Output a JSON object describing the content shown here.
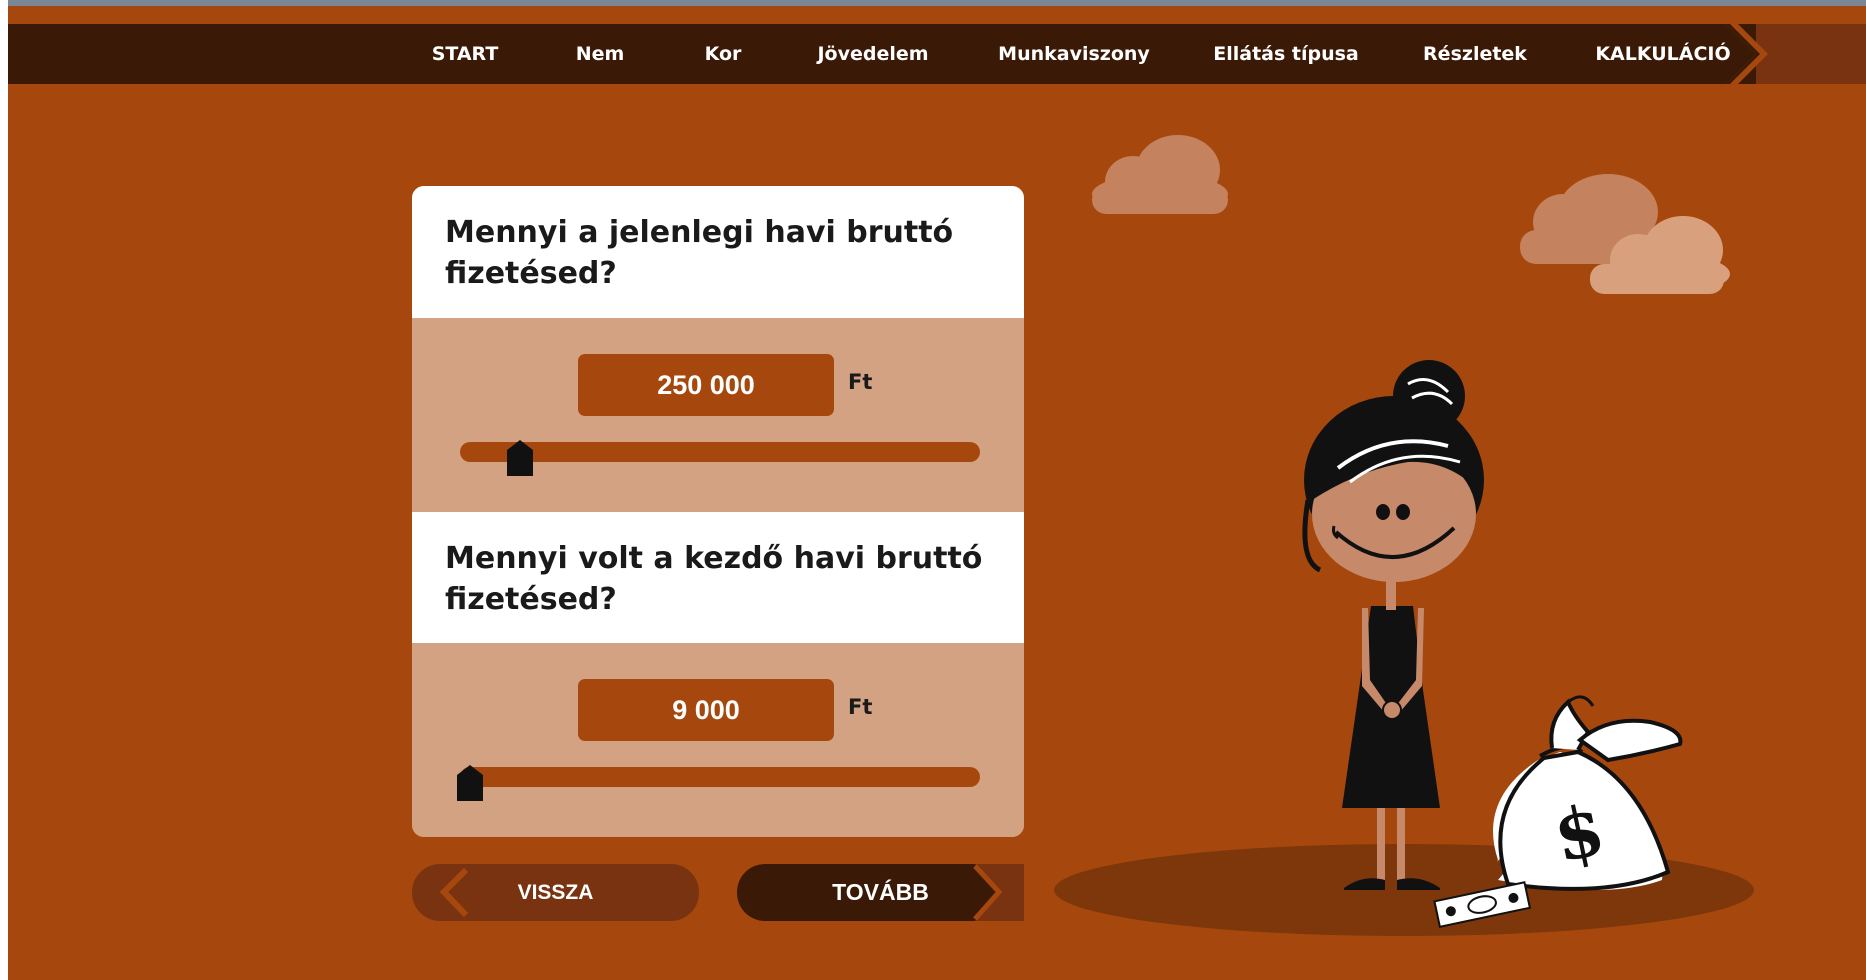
{
  "nav": {
    "items": [
      "START",
      "Nem",
      "Kor",
      "Jövedelem",
      "Munkaviszony",
      "Ellátás típusa",
      "Részletek",
      "KALKULÁCIÓ"
    ],
    "active": "KALKULÁCIÓ"
  },
  "questions": [
    {
      "title": "Mennyi a jelenlegi havi bruttó fizetésed?",
      "value": "250 000",
      "unit": "Ft",
      "slider_fraction": 0.1
    },
    {
      "title": "Mennyi volt a kezdő havi bruttó fizetésed?",
      "value": "9 000",
      "unit": "Ft",
      "slider_fraction": 0.0
    }
  ],
  "buttons": {
    "back_label": "VISSZA",
    "next_label": "TOVÁBB"
  },
  "colors": {
    "background": "#a6480d",
    "navbar": "#3a1a06",
    "panel": "#d2a282",
    "back_button": "#7a3310",
    "next_button": "#3a1a06"
  },
  "illustration": {
    "icons": [
      "cloud-icon",
      "woman-illustration",
      "money-bag-icon",
      "dollar-sign-icon",
      "banknote-icon"
    ]
  }
}
